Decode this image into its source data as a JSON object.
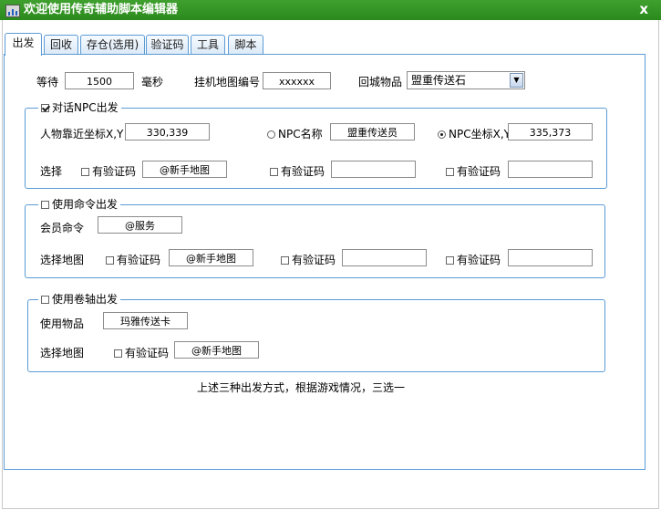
{
  "window": {
    "title": "欢迎使用传奇辅助脚本编辑器",
    "close_glyph": "x"
  },
  "tabs": [
    {
      "label": "出发",
      "active": true
    },
    {
      "label": "回收"
    },
    {
      "label": "存仓(选用)"
    },
    {
      "label": "验证码"
    },
    {
      "label": "工具"
    },
    {
      "label": "脚本"
    }
  ],
  "general": {
    "wait_label": "等待",
    "wait_value": "1500",
    "wait_unit": "毫秒",
    "map_id_label": "挂机地图编号",
    "map_id_value": "xxxxxx",
    "return_item_label": "回城物品",
    "return_item_value": "盟重传送石"
  },
  "npc_group": {
    "title": "对话NPC出发",
    "checked": true,
    "pos_label": "人物靠近坐标X,Y",
    "pos_value": "330,339",
    "npc_name_label": "NPC名称",
    "npc_name_value": "盟重传送员",
    "npc_coord_label": "NPC坐标X,Y",
    "npc_coord_value": "335,373",
    "select_label": "选择",
    "captcha_label": "有验证码",
    "option1_value": "@新手地图",
    "option2_value": "",
    "option3_value": ""
  },
  "command_group": {
    "title": "使用命令出发",
    "member_cmd_label": "会员命令",
    "member_cmd_value": "@服务",
    "select_map_label": "选择地图",
    "captcha_label": "有验证码",
    "option1_value": "@新手地图",
    "option2_value": "",
    "option3_value": ""
  },
  "scroll_group": {
    "title": "使用卷轴出发",
    "use_item_label": "使用物品",
    "use_item_value": "玛雅传送卡",
    "select_map_label": "选择地图",
    "captcha_label": "有验证码",
    "option1_value": "@新手地图"
  },
  "footer_note": "上述三种出发方式，根据游戏情况，三选一",
  "colors": {
    "titlebar": "#2e8f22",
    "border_blue": "#5b9bd5"
  }
}
